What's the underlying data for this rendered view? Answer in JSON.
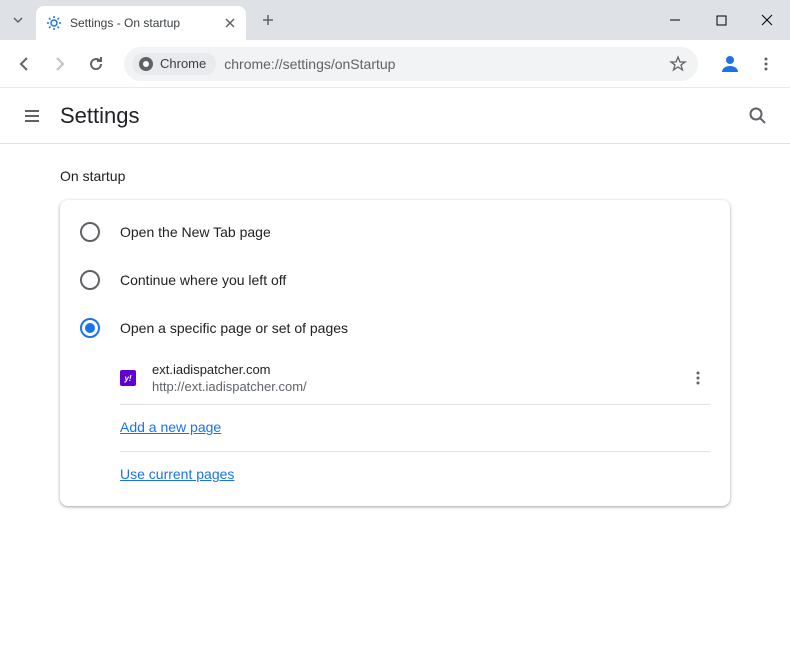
{
  "titlebar": {
    "tab_title": "Settings - On startup"
  },
  "toolbar": {
    "chrome_chip": "Chrome",
    "url": "chrome://settings/onStartup"
  },
  "header": {
    "title": "Settings"
  },
  "section": {
    "title": "On startup",
    "options": [
      {
        "label": "Open the New Tab page",
        "checked": false
      },
      {
        "label": "Continue where you left off",
        "checked": false
      },
      {
        "label": "Open a specific page or set of pages",
        "checked": true
      }
    ],
    "pages": [
      {
        "title": "ext.iadispatcher.com",
        "url": "http://ext.iadispatcher.com/"
      }
    ],
    "add_page_label": "Add a new page",
    "use_current_label": "Use current pages"
  }
}
